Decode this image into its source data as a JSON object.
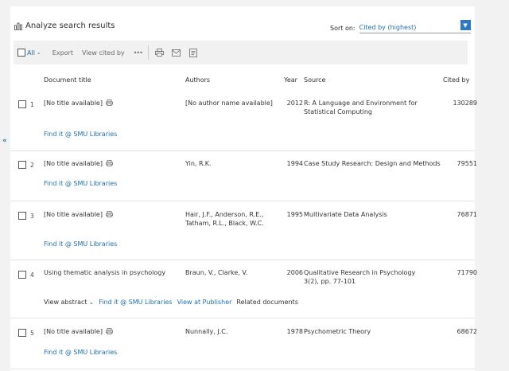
{
  "header": {
    "title": "Analyze search results",
    "sort_label": "Sort on:",
    "sort_value": "Cited by (highest)"
  },
  "toolbar": {
    "all_label": "All",
    "export_label": "Export",
    "view_cited_label": "View cited by",
    "more_label": "•••"
  },
  "columns": {
    "title": "Document title",
    "authors": "Authors",
    "year": "Year",
    "source": "Source",
    "cited": "Cited by"
  },
  "rows": [
    {
      "num": "1",
      "title": "[No title available]",
      "authors": "[No author name available]",
      "year": "2012",
      "source": "R: A Language and Environment for Statistical Computing",
      "cited": "130289",
      "find_it": "Find it @ SMU Libraries"
    },
    {
      "num": "2",
      "title": "[No title available]",
      "authors": "Yin, R.K.",
      "year": "1994",
      "source": "Case Study Research: Design and Methods",
      "cited": "79551",
      "find_it": "Find it @ SMU Libraries"
    },
    {
      "num": "3",
      "title": "[No title available]",
      "authors": "Hair, J.F., Anderson, R.E., Tatham, R.L., Black, W.C.",
      "year": "1995",
      "source": "Multivariate Data Analysis",
      "cited": "76871",
      "find_it": "Find it @ SMU Libraries"
    },
    {
      "num": "4",
      "title": "Using thematic analysis in psychology",
      "authors": "Braun, V., Clarke, V.",
      "year": "2006",
      "source": "Qualitative Research in Psychology",
      "source_detail": "3(2), pp. 77-101",
      "cited": "71790",
      "view_abstract": "View abstract",
      "find_it": "Find it @ SMU Libraries",
      "view_publisher": "View at Publisher",
      "related": "Related documents"
    },
    {
      "num": "5",
      "title": "[No title available]",
      "authors": "Nunnally, J.C.",
      "year": "1978",
      "source": "Psychometric Theory",
      "cited": "68672",
      "find_it": "Find it @ SMU Libraries"
    }
  ],
  "colors": {
    "link": "#1f6fa8",
    "accent_button": "#2e78c2",
    "toolbar_bg": "#f1f1f1"
  }
}
